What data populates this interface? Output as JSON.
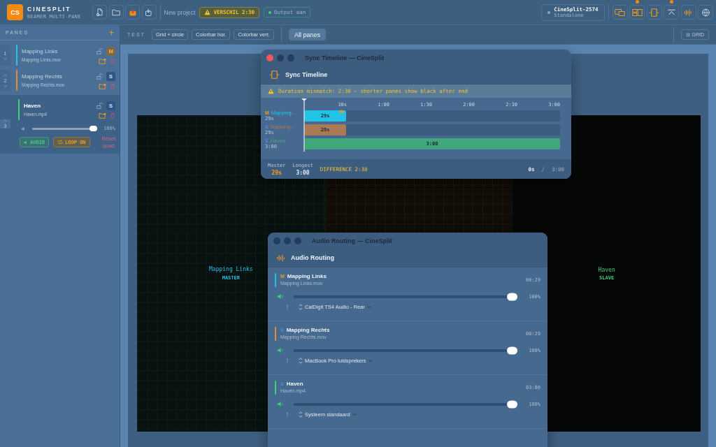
{
  "app": {
    "logo": "CS",
    "name": "CINESPLIT",
    "subtitle": "BEAMER MULTI-PANE"
  },
  "file_tools": [
    {
      "kind": "new",
      "active": false
    },
    {
      "kind": "open",
      "active": false
    },
    {
      "kind": "import",
      "active": true
    },
    {
      "kind": "export",
      "active": false
    }
  ],
  "project_name": "New project",
  "warning_badge": "VERSCHIL 2:30",
  "output": {
    "label": "Output aan",
    "on": true
  },
  "device": {
    "name": "CineSplit-2574",
    "mode": "Standalone",
    "online": false
  },
  "view_tools": [
    {
      "kind": "displays",
      "indicator": false
    },
    {
      "kind": "layout",
      "indicator": true
    },
    {
      "kind": "timeline",
      "indicator": false
    },
    {
      "kind": "collapse",
      "indicator": true
    },
    {
      "kind": "audio",
      "indicator": false
    },
    {
      "kind": "globe",
      "indicator": false
    }
  ],
  "sidebar": {
    "title": "PANES",
    "add": "+",
    "panes": [
      {
        "number": "1",
        "name": "Mapping Links",
        "file": "Mapping Links.mov",
        "color": "#22c3e6",
        "role": "M",
        "selected": false
      },
      {
        "number": "2",
        "name": "Mapping Rechts",
        "file": "Mapping Rechts.mov",
        "color": "#e8893a",
        "role": "S",
        "selected": false
      },
      {
        "number": "3",
        "name": "Haven",
        "file": "Haven.mp4",
        "color": "#3fd17a",
        "role": "S",
        "selected": true
      }
    ],
    "volume": {
      "level": 1,
      "reading": "100%"
    },
    "audio_button": "AUDIO",
    "loop_button": "LOOP ON",
    "reset": "Reset\nquad"
  },
  "test_bar": {
    "label": "TEST",
    "patterns": [
      "Grid + circle",
      "Colorbar hor.",
      "Colorbar vert."
    ],
    "all_panes": "All panes",
    "grid": "GRID"
  },
  "stage": [
    {
      "name": "Mapping Links",
      "role": "MASTER",
      "selected": false
    },
    {
      "selected": false
    },
    {
      "name": "Haven",
      "role": "SLAVE",
      "selected": true
    }
  ],
  "sync_window": {
    "title": "Sync Timeline — CineSplit",
    "heading": "Sync Timeline",
    "warning": "Duration mismatch: 2:30 — shorter panes show black after end",
    "ticks": [
      "30s",
      "1:00",
      "1:30",
      "2:00",
      "2:30",
      "3:00"
    ],
    "tracks": [
      {
        "role": "M",
        "name": "Mapping...",
        "duration": "29s",
        "bar_label": "29s",
        "color": "#22c3e6",
        "level": 0.165
      },
      {
        "role": "S",
        "name": "Mapping...",
        "duration": "29s",
        "bar_label": "29s",
        "color": "#a97a55",
        "level": 0.165
      },
      {
        "role": "S",
        "name": "Haven",
        "duration": "3:00",
        "bar_label": "3:00",
        "color": "#3fa77a",
        "level": 1
      }
    ],
    "master_label": "Master",
    "master_value": "29s",
    "longest_label": "Longest",
    "longest_value": "3:00",
    "difference": "DIFFERENCE 2:30",
    "position": "0s",
    "separator": "/",
    "total": "3:00"
  },
  "audio_window": {
    "title": "Audio Routing — CineSplit",
    "heading": "Audio Routing",
    "channels": [
      {
        "role": "M",
        "name": "Mapping Links",
        "file": "Mapping Links.mov",
        "duration": "00:29",
        "color": "#22c3e6",
        "level": 1,
        "reading": "100%",
        "output": "CalDigit TS4 Audio - Rear"
      },
      {
        "role": "S",
        "name": "Mapping Rechts",
        "file": "Mapping Rechts.mov",
        "duration": "00:29",
        "color": "#e8893a",
        "level": 1,
        "reading": "100%",
        "output": "MacBook Pro luidsprekers"
      },
      {
        "role": "S",
        "name": "Haven",
        "file": "Haven.mp4",
        "duration": "03:00",
        "color": "#3fd17a",
        "level": 1,
        "reading": "100%",
        "output": "Systeem standaard"
      }
    ]
  }
}
